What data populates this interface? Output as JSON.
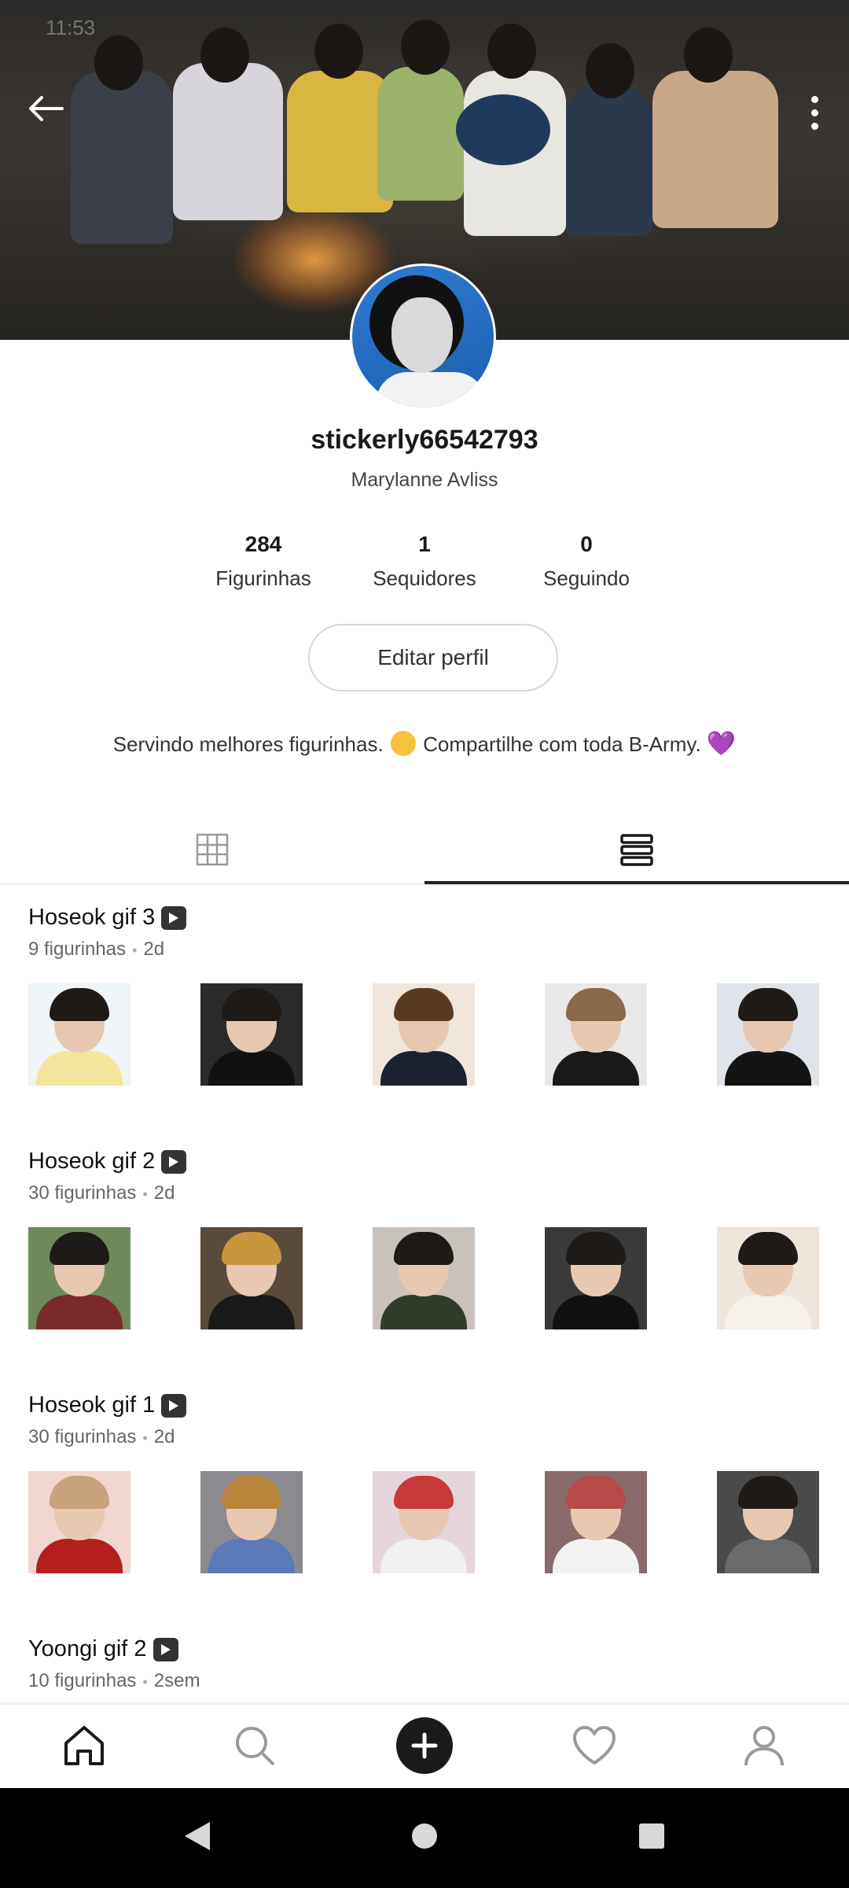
{
  "status": {
    "time": "11:53"
  },
  "header": {
    "back_icon": "arrow-left-icon",
    "menu_icon": "more-vert-icon"
  },
  "profile": {
    "username": "stickerly66542793",
    "display_name": "Marylanne Avliss",
    "stats": [
      {
        "value": "284",
        "label": "Figurinhas"
      },
      {
        "value": "1",
        "label": "Sequidores"
      },
      {
        "value": "0",
        "label": "Seguindo"
      }
    ],
    "edit_label": "Editar perfil",
    "bio_part1": "Servindo melhores figurinhas.",
    "bio_part2": "Compartilhe com toda B-Army.",
    "bio_heart": "💜"
  },
  "tabs": [
    {
      "icon": "grid-icon",
      "active": false
    },
    {
      "icon": "list-icon",
      "active": true
    }
  ],
  "packs": [
    {
      "title": "Hoseok gif 3",
      "count": "9 figurinhas",
      "age": "2d"
    },
    {
      "title": "Hoseok gif 2",
      "count": "30 figurinhas",
      "age": "2d"
    },
    {
      "title": "Hoseok gif 1",
      "count": "30 figurinhas",
      "age": "2d"
    },
    {
      "title": "Yoongi gif 2",
      "count": "10 figurinhas",
      "age": "2sem"
    }
  ],
  "bottom_nav": [
    {
      "icon": "home-icon",
      "active": true
    },
    {
      "icon": "search-icon"
    },
    {
      "icon": "add-icon"
    },
    {
      "icon": "heart-icon"
    },
    {
      "icon": "profile-icon"
    }
  ],
  "colors": {
    "accent": "#222222",
    "heart": "#9b4fd8",
    "cover_fire": "#ffaa46"
  }
}
